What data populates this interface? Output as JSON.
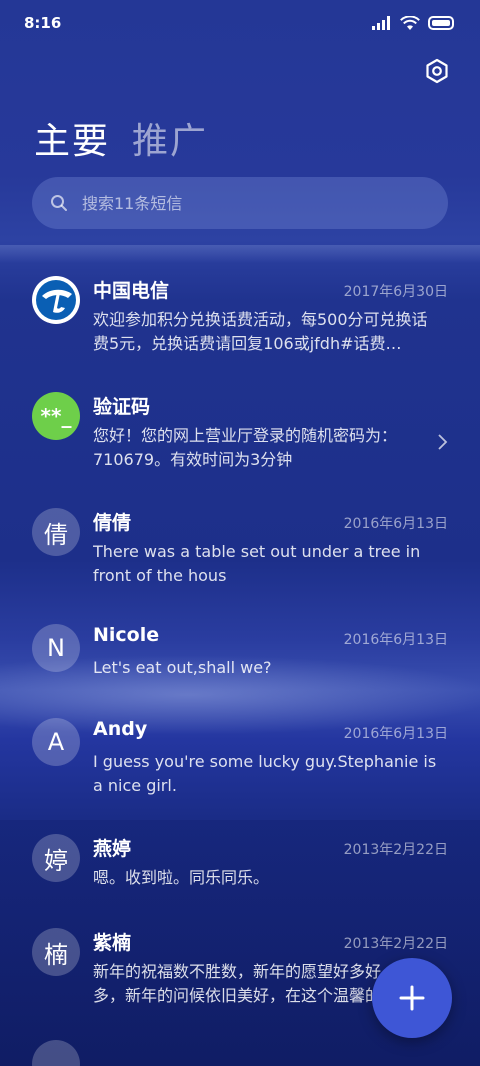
{
  "status_bar": {
    "time": "8:16"
  },
  "tabs": [
    {
      "label": "主要",
      "active": true
    },
    {
      "label": "推广",
      "active": false
    }
  ],
  "search": {
    "placeholder": "搜索11条短信"
  },
  "messages": [
    {
      "sender": "中国电信",
      "date": "2017年6月30日",
      "preview": "欢迎参加积分兑换话费活动，每500分可兑换话费5元，兑换话费请回复106或jfdh#话费…",
      "avatar": "telecom-logo"
    },
    {
      "sender": "验证码",
      "date": "",
      "preview": "您好！您的网上营业厅登录的随机密码为：710679。有效时间为3分钟",
      "avatar_text": "**_"
    },
    {
      "sender": "倩倩",
      "date": "2016年6月13日",
      "preview": "There was a table set out under a tree in front of the hous",
      "avatar_text": "倩"
    },
    {
      "sender": "Nicole",
      "date": "2016年6月13日",
      "preview": "Let's eat out,shall we?",
      "avatar_text": "N"
    },
    {
      "sender": "Andy",
      "date": "2016年6月13日",
      "preview": "I guess you're some lucky guy.Stephanie is a nice girl.",
      "avatar_text": "A"
    },
    {
      "sender": "燕婷",
      "date": "2013年2月22日",
      "preview": "嗯。收到啦。同乐同乐。",
      "avatar_text": "婷"
    },
    {
      "sender": "紫楠",
      "date": "2013年2月22日",
      "preview": "新年的祝福数不胜数，新年的愿望好多好多，新年的问候依旧美好，在这个温馨的",
      "avatar_text": "楠"
    }
  ],
  "icons": {
    "settings": "gear-icon",
    "search": "search-icon",
    "compose": "plus-icon",
    "wifi": "wifi-icon",
    "signal": "signal-icon",
    "battery": "battery-icon"
  },
  "colors": {
    "accent": "#3e56d6",
    "code_avatar": "#6ecf4a"
  }
}
